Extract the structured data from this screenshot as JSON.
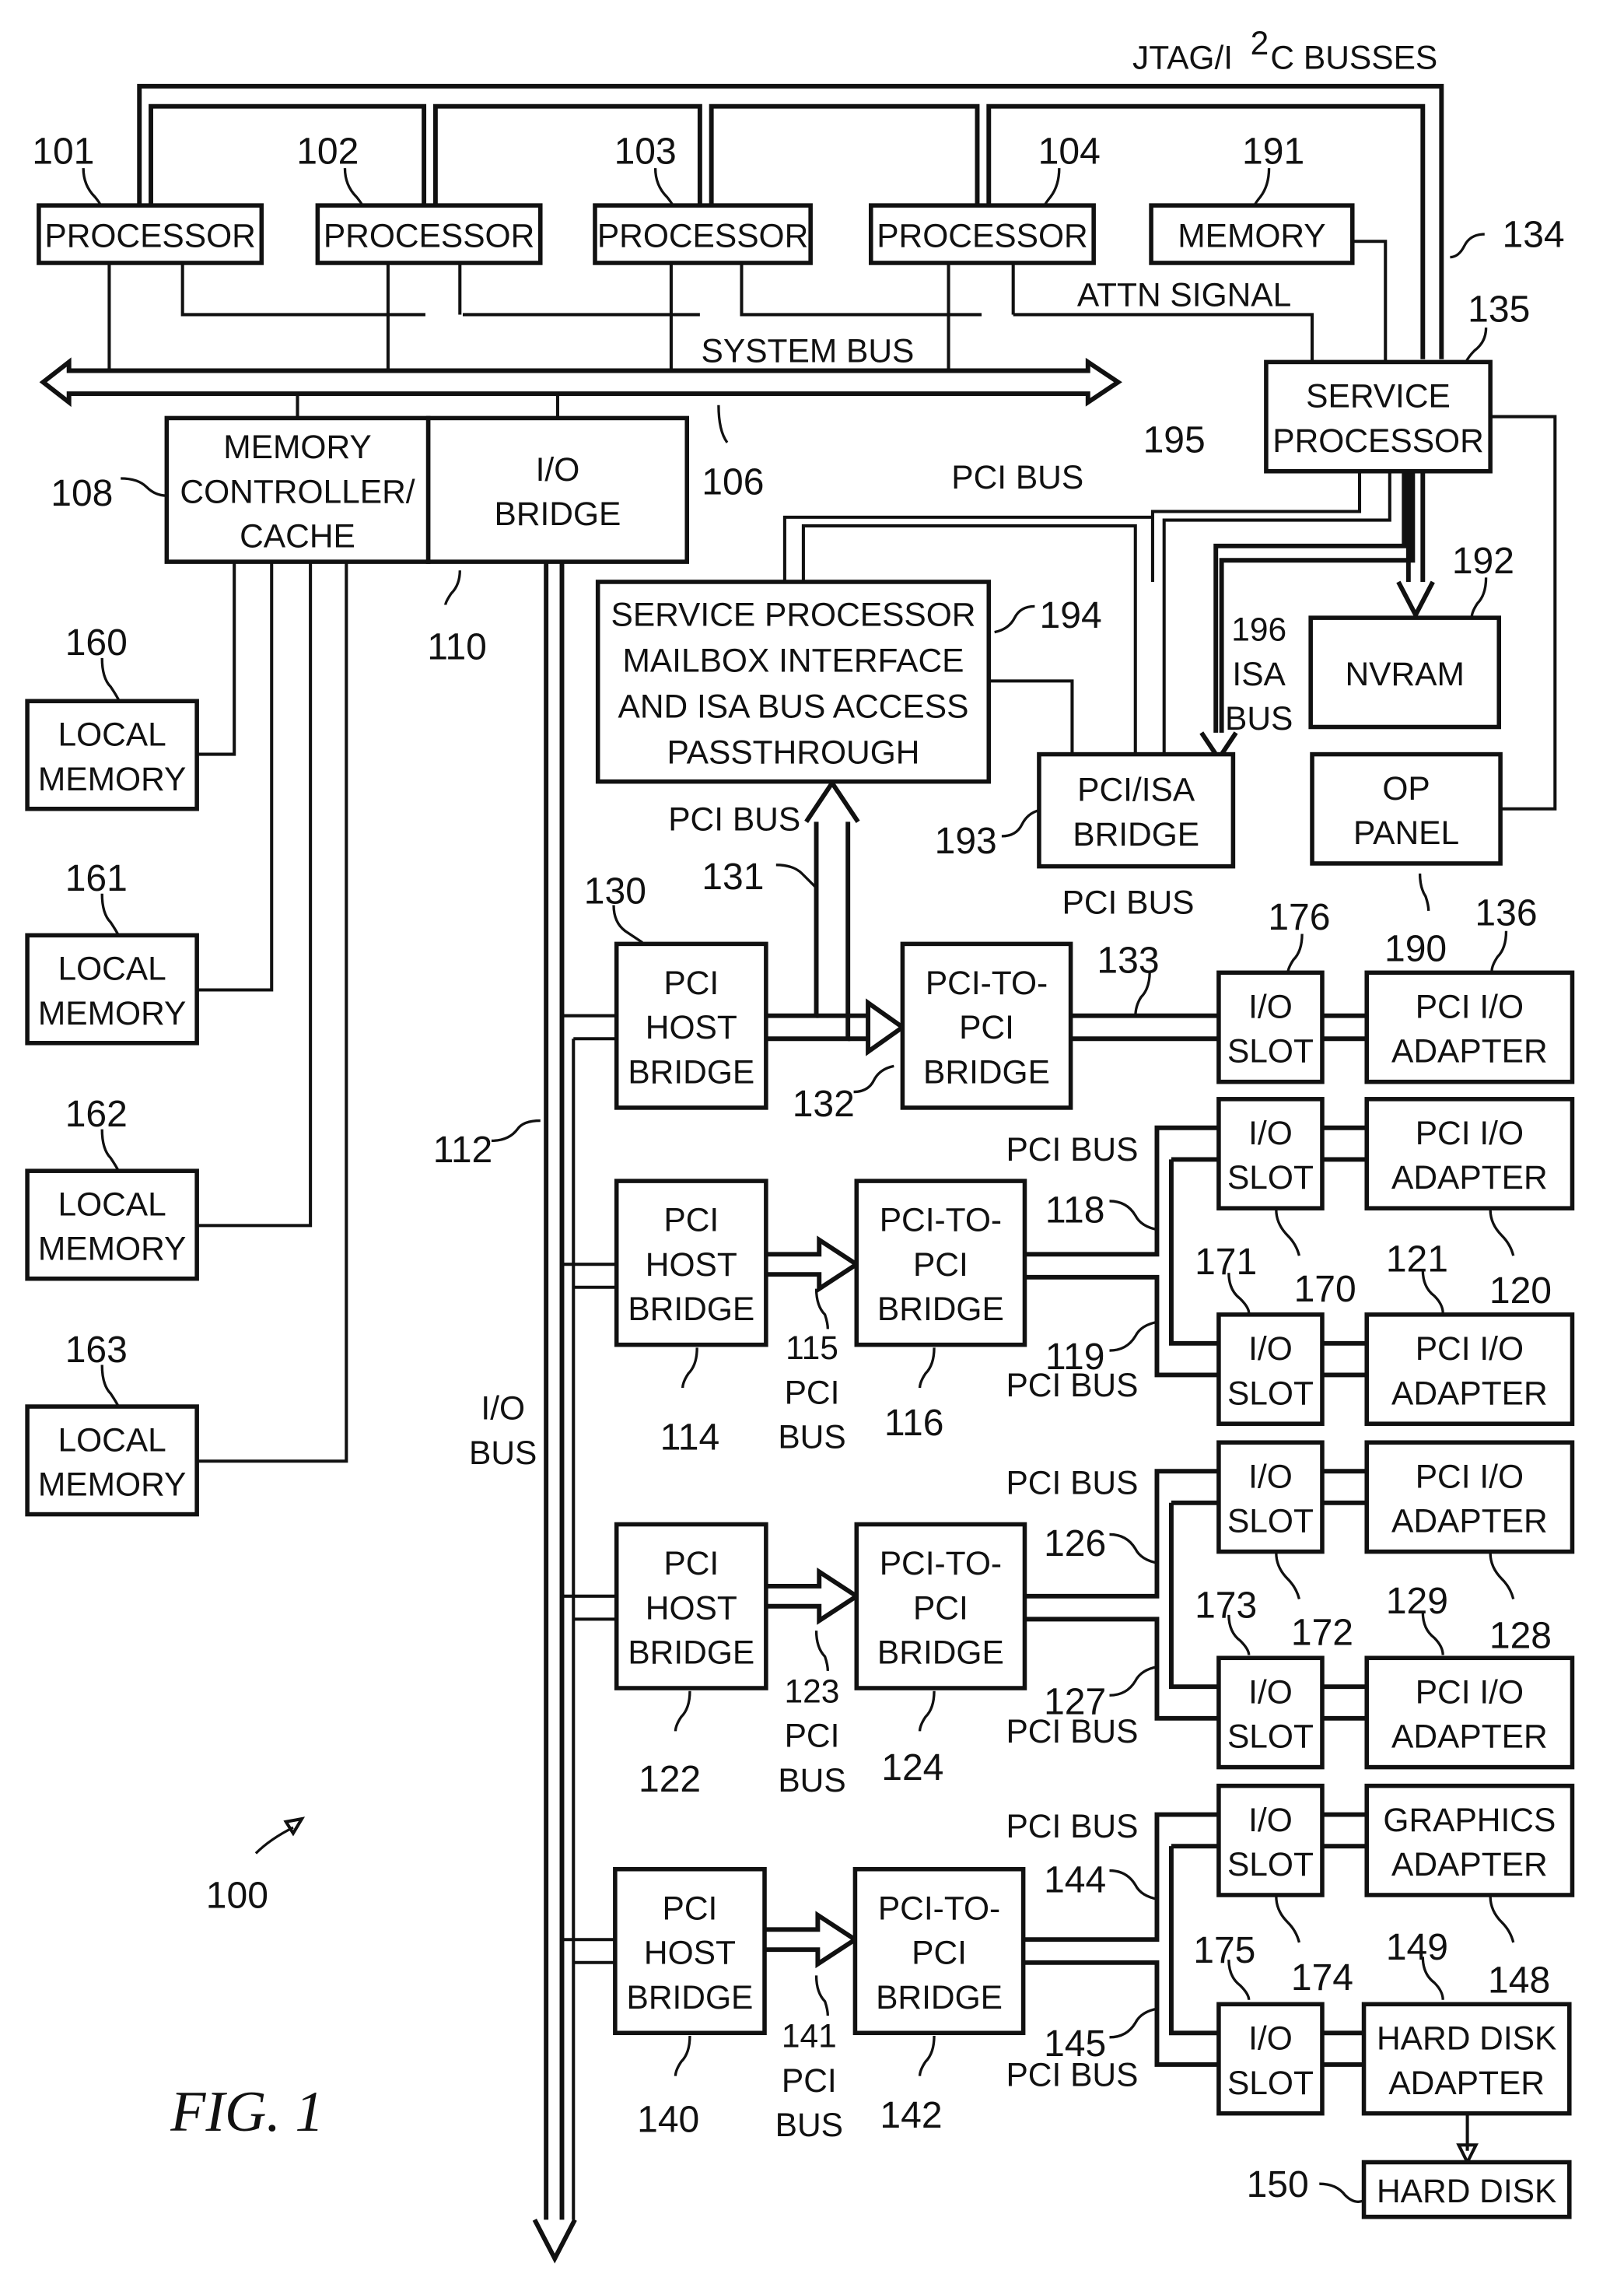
{
  "figure": {
    "caption": "FIG. 1",
    "system_ref": "100",
    "bus_labels": {
      "jtag": "JTAG/I",
      "jtag_sup": "2",
      "jtag_rest": "C BUSSES",
      "system_bus": "SYSTEM BUS",
      "attn": "ATTN SIGNAL",
      "pci_bus_195": "PCI BUS",
      "pci_bus_131": "PCI BUS",
      "pci_bus_133": "PCI BUS",
      "pci_bus_118": "PCI BUS",
      "pci_bus_119": "PCI BUS",
      "pci_bus_126": "PCI BUS",
      "pci_bus_127": "PCI BUS",
      "pci_bus_144": "PCI BUS",
      "pci_bus_145": "PCI BUS",
      "isa_bus": [
        "196",
        "ISA",
        "BUS"
      ],
      "io_bus": [
        "I/O",
        "BUS"
      ],
      "pci_115": [
        "115",
        "PCI",
        "BUS"
      ],
      "pci_123": [
        "123",
        "PCI",
        "BUS"
      ],
      "pci_141": [
        "141",
        "PCI",
        "BUS"
      ]
    },
    "blocks": {
      "p101": {
        "ref": "101",
        "lines": [
          "PROCESSOR"
        ]
      },
      "p102": {
        "ref": "102",
        "lines": [
          "PROCESSOR"
        ]
      },
      "p103": {
        "ref": "103",
        "lines": [
          "PROCESSOR"
        ]
      },
      "p104": {
        "ref": "104",
        "lines": [
          "PROCESSOR"
        ]
      },
      "m191": {
        "ref": "191",
        "lines": [
          "MEMORY"
        ]
      },
      "sp135": {
        "ref": "135",
        "lines": [
          "SERVICE",
          "PROCESSOR"
        ]
      },
      "mc108": {
        "ref": "108",
        "lines": [
          "MEMORY",
          "CONTROLLER/",
          "CACHE"
        ]
      },
      "iob110": {
        "ref": "110",
        "lines": [
          "I/O",
          "BRIDGE"
        ]
      },
      "lm160": {
        "ref": "160",
        "lines": [
          "LOCAL",
          "MEMORY"
        ]
      },
      "lm161": {
        "ref": "161",
        "lines": [
          "LOCAL",
          "MEMORY"
        ]
      },
      "lm162": {
        "ref": "162",
        "lines": [
          "LOCAL",
          "MEMORY"
        ]
      },
      "lm163": {
        "ref": "163",
        "lines": [
          "LOCAL",
          "MEMORY"
        ]
      },
      "spm194": {
        "ref": "194",
        "lines": [
          "SERVICE PROCESSOR",
          "MAILBOX INTERFACE",
          "AND ISA BUS ACCESS",
          "PASSTHROUGH"
        ]
      },
      "nv192": {
        "ref": "192",
        "lines": [
          "NVRAM"
        ]
      },
      "pib193": {
        "ref": "193",
        "lines": [
          "PCI/ISA",
          "BRIDGE"
        ]
      },
      "op190": {
        "ref": "190",
        "lines": [
          "OP",
          "PANEL"
        ]
      },
      "phb130": {
        "ref": "130",
        "lines": [
          "PCI",
          "HOST",
          "BRIDGE"
        ]
      },
      "ptp132": {
        "ref": "132",
        "lines": [
          "PCI-TO-",
          "PCI",
          "BRIDGE"
        ]
      },
      "slot176": {
        "ref": "176",
        "lines": [
          "I/O",
          "SLOT"
        ]
      },
      "ad136": {
        "ref": "136",
        "lines": [
          "PCI I/O",
          "ADAPTER"
        ]
      },
      "phb114": {
        "ref": "114",
        "lines": [
          "PCI",
          "HOST",
          "BRIDGE"
        ]
      },
      "ptp116": {
        "ref": "116",
        "lines": [
          "PCI-TO-",
          "PCI",
          "BRIDGE"
        ]
      },
      "slot170": {
        "ref": "170",
        "lines": [
          "I/O",
          "SLOT"
        ]
      },
      "ad120": {
        "ref": "120",
        "lines": [
          "PCI I/O",
          "ADAPTER"
        ]
      },
      "slot171": {
        "ref": "171",
        "lines": [
          "I/O",
          "SLOT"
        ]
      },
      "ad121": {
        "ref": "121",
        "lines": [
          "PCI I/O",
          "ADAPTER"
        ]
      },
      "phb122": {
        "ref": "122",
        "lines": [
          "PCI",
          "HOST",
          "BRIDGE"
        ]
      },
      "ptp124": {
        "ref": "124",
        "lines": [
          "PCI-TO-",
          "PCI",
          "BRIDGE"
        ]
      },
      "slot172": {
        "ref": "172",
        "lines": [
          "I/O",
          "SLOT"
        ]
      },
      "ad128": {
        "ref": "128",
        "lines": [
          "PCI I/O",
          "ADAPTER"
        ]
      },
      "slot173": {
        "ref": "173",
        "lines": [
          "I/O",
          "SLOT"
        ]
      },
      "ad129": {
        "ref": "129",
        "lines": [
          "PCI I/O",
          "ADAPTER"
        ]
      },
      "phb140": {
        "ref": "140",
        "lines": [
          "PCI",
          "HOST",
          "BRIDGE"
        ]
      },
      "ptp142": {
        "ref": "142",
        "lines": [
          "PCI-TO-",
          "PCI",
          "BRIDGE"
        ]
      },
      "slot174": {
        "ref": "174",
        "lines": [
          "I/O",
          "SLOT"
        ]
      },
      "ad148": {
        "ref": "148",
        "lines": [
          "GRAPHICS",
          "ADAPTER"
        ]
      },
      "slot175": {
        "ref": "175",
        "lines": [
          "I/O",
          "SLOT"
        ]
      },
      "ad149": {
        "ref": "149",
        "lines": [
          "HARD DISK",
          "ADAPTER"
        ]
      },
      "hd150": {
        "ref": "150",
        "lines": [
          "HARD DISK"
        ]
      }
    },
    "bus_refs": {
      "r106": "106",
      "r134": "134",
      "r195": "195",
      "r112": "112",
      "r131": "131",
      "r133": "133",
      "r118": "118",
      "r119": "119",
      "r126": "126",
      "r127": "127",
      "r144": "144",
      "r145": "145"
    }
  }
}
